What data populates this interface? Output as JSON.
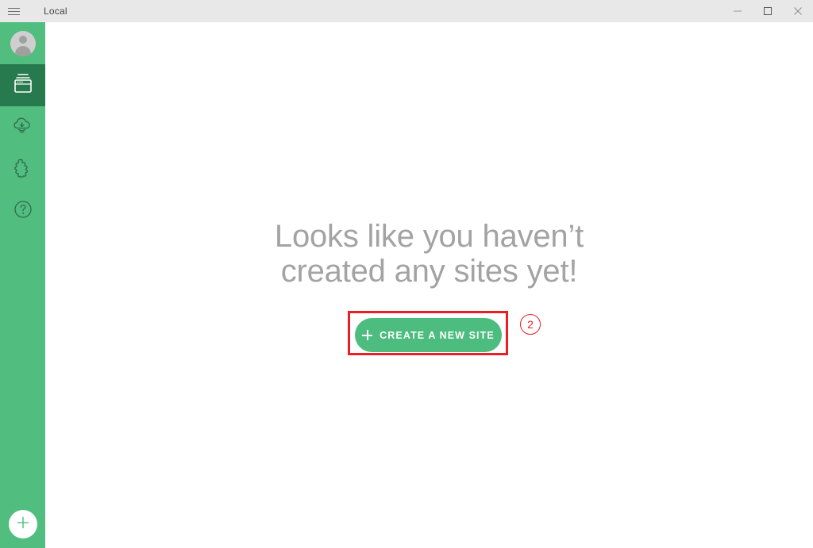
{
  "window": {
    "title": "Local",
    "menu_icon": "hamburger-icon",
    "controls": [
      {
        "name": "minimize",
        "glyph": "–"
      },
      {
        "name": "maximize",
        "glyph": "□"
      },
      {
        "name": "close",
        "glyph": "×"
      }
    ]
  },
  "sidebar": {
    "background": "#51bd7e",
    "active_background": "#267a4d",
    "items": [
      {
        "id": "account",
        "icon": "user-avatar-icon",
        "label": "Account",
        "active": false
      },
      {
        "id": "sites",
        "icon": "sites-window-icon",
        "label": "Local Sites",
        "active": true
      },
      {
        "id": "blueprints",
        "icon": "cloud-download-icon",
        "label": "Blueprints",
        "active": false
      },
      {
        "id": "addons",
        "icon": "puzzle-piece-icon",
        "label": "Add-ons",
        "active": false
      },
      {
        "id": "help",
        "icon": "question-mark-circle-icon",
        "label": "Help",
        "active": false
      }
    ],
    "add_button": {
      "icon": "plus-circle-icon",
      "label": "Add"
    }
  },
  "main": {
    "empty_state": {
      "heading": "Looks like you haven’t\ncreated any sites yet!",
      "heading_color": "#a3a3a3",
      "cta_label": "CREATE A NEW SITE",
      "cta_icon": "plus-icon",
      "cta_color": "#4cbd7e"
    }
  },
  "annotation": {
    "number": "2",
    "color": "#ee1d24"
  }
}
